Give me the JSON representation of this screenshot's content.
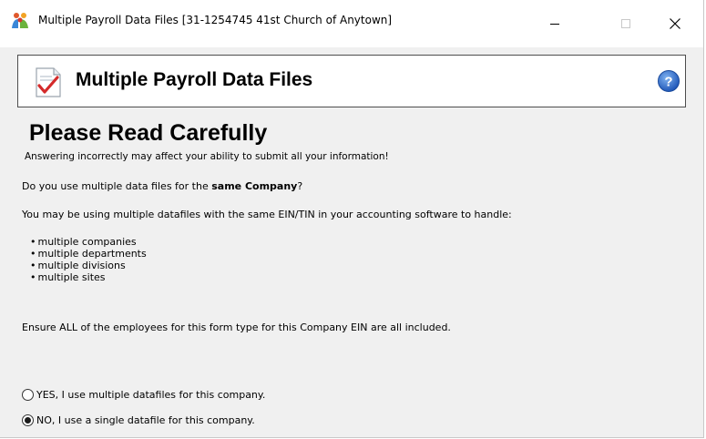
{
  "window": {
    "title": "Multiple Payroll Data Files [31-1254745 41st Church of Anytown]",
    "controls": {
      "minimize_icon": "minimize-icon",
      "maximize_icon": "maximize-icon",
      "close_icon": "close-icon"
    }
  },
  "header": {
    "title": "Multiple Payroll Data Files",
    "icon": "document-check-icon",
    "help_icon": "help-icon",
    "help_color": "#2b66c9"
  },
  "content": {
    "heading": "Please Read Carefully",
    "warning": "Answering incorrectly may affect your ability to submit all your information!",
    "question_prefix": "Do you use multiple data files for the ",
    "question_bold": "same Company",
    "question_suffix": "?",
    "intro": "You may be using multiple datafiles with the same EIN/TIN in your accounting software to handle:",
    "bullets": [
      "multiple companies",
      "multiple departments",
      "multiple divisions",
      "multiple sites"
    ],
    "ensure": "Ensure ALL of the employees for this form type for this Company EIN are all included."
  },
  "options": [
    {
      "label": "YES, I use multiple datafiles for this company.",
      "selected": false
    },
    {
      "label": "NO, I use a single datafile for this company.",
      "selected": true
    }
  ]
}
